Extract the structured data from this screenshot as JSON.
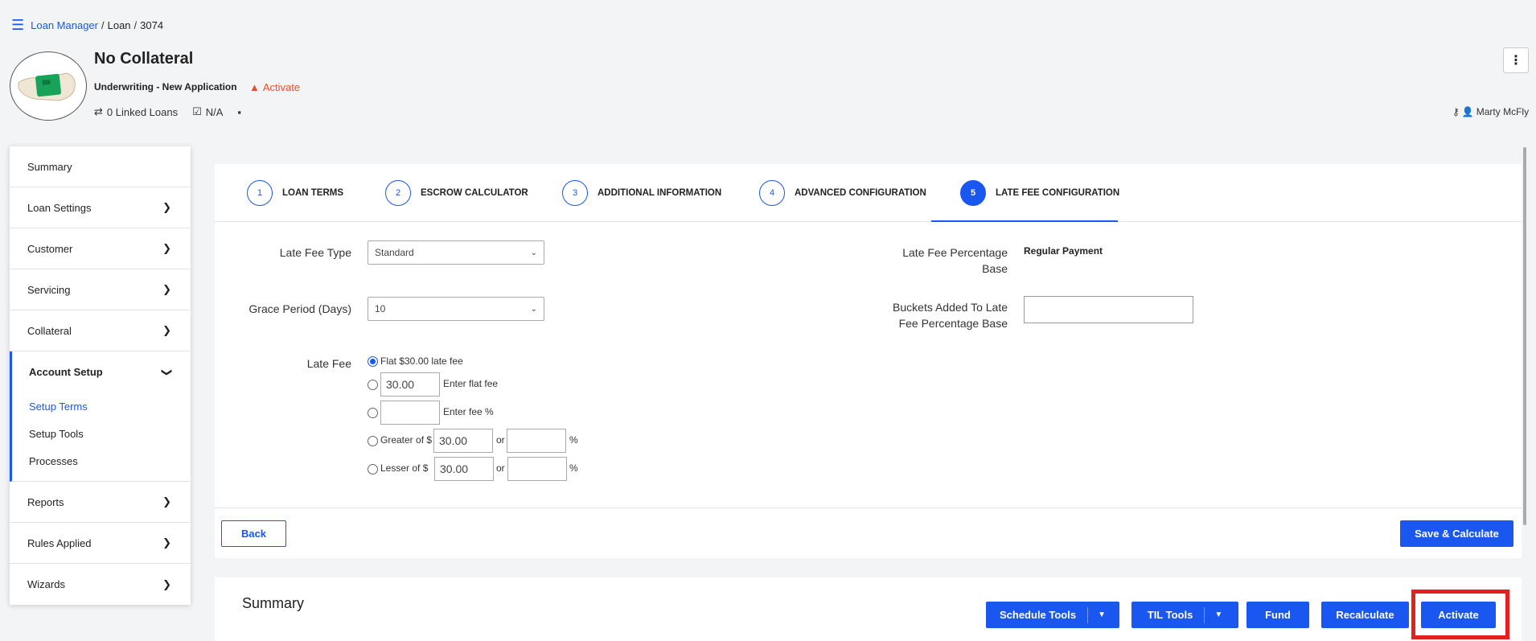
{
  "breadcrumb": {
    "root": "Loan Manager",
    "middle": "Loan",
    "id": "3074"
  },
  "header": {
    "title": "No Collateral",
    "status": "Underwriting - New Application",
    "activate_warning": "Activate",
    "linked_loans": "0 Linked Loans",
    "date": "N/A",
    "user": "Marty McFly"
  },
  "sidebar": {
    "items_top": [
      {
        "label": "Summary"
      },
      {
        "label": "Loan Settings"
      },
      {
        "label": "Customer"
      },
      {
        "label": "Servicing"
      },
      {
        "label": "Collateral"
      }
    ],
    "active": {
      "label": "Account Setup",
      "subitems": [
        {
          "label": "Setup Terms"
        },
        {
          "label": "Setup Tools"
        },
        {
          "label": "Processes"
        }
      ]
    },
    "items_bottom": [
      {
        "label": "Reports"
      },
      {
        "label": "Rules Applied"
      },
      {
        "label": "Wizards"
      }
    ]
  },
  "tabs": [
    {
      "num": "1",
      "label": "LOAN TERMS"
    },
    {
      "num": "2",
      "label": "ESCROW CALCULATOR"
    },
    {
      "num": "3",
      "label": "ADDITIONAL INFORMATION"
    },
    {
      "num": "4",
      "label": "ADVANCED CONFIGURATION"
    },
    {
      "num": "5",
      "label": "LATE FEE CONFIGURATION"
    }
  ],
  "form": {
    "late_fee_type_label": "Late Fee Type",
    "late_fee_type_value": "Standard",
    "grace_period_label": "Grace Period (Days)",
    "grace_period_value": "10",
    "late_fee_label": "Late Fee",
    "pct_base_label_1": "Late Fee Percentage",
    "pct_base_label_2": "Base",
    "pct_base_value": "Regular Payment",
    "buckets_label_1": "Buckets Added To Late",
    "buckets_label_2": "Fee Percentage Base",
    "buckets_value": "",
    "options": {
      "flat_default": "Flat $30.00 late fee",
      "flat_amount": "30.00",
      "flat_text": "Enter flat fee",
      "pct_amount": "",
      "pct_text": "Enter fee %",
      "greater_text": "Greater of $",
      "greater_amount": "30.00",
      "greater_pct": "",
      "lesser_text": "Lesser of $",
      "lesser_amount": "30.00",
      "lesser_pct": "",
      "or": "or",
      "pct_sign": "%"
    }
  },
  "buttons": {
    "back": "Back",
    "save": "Save & Calculate"
  },
  "summary": {
    "title": "Summary",
    "schedule_tools": "Schedule Tools",
    "til_tools": "TIL Tools",
    "fund": "Fund",
    "recalculate": "Recalculate",
    "activate": "Activate"
  },
  "colors": {
    "accent": "#1a56f0",
    "warning": "#e8512c",
    "highlight": "#e32020"
  }
}
